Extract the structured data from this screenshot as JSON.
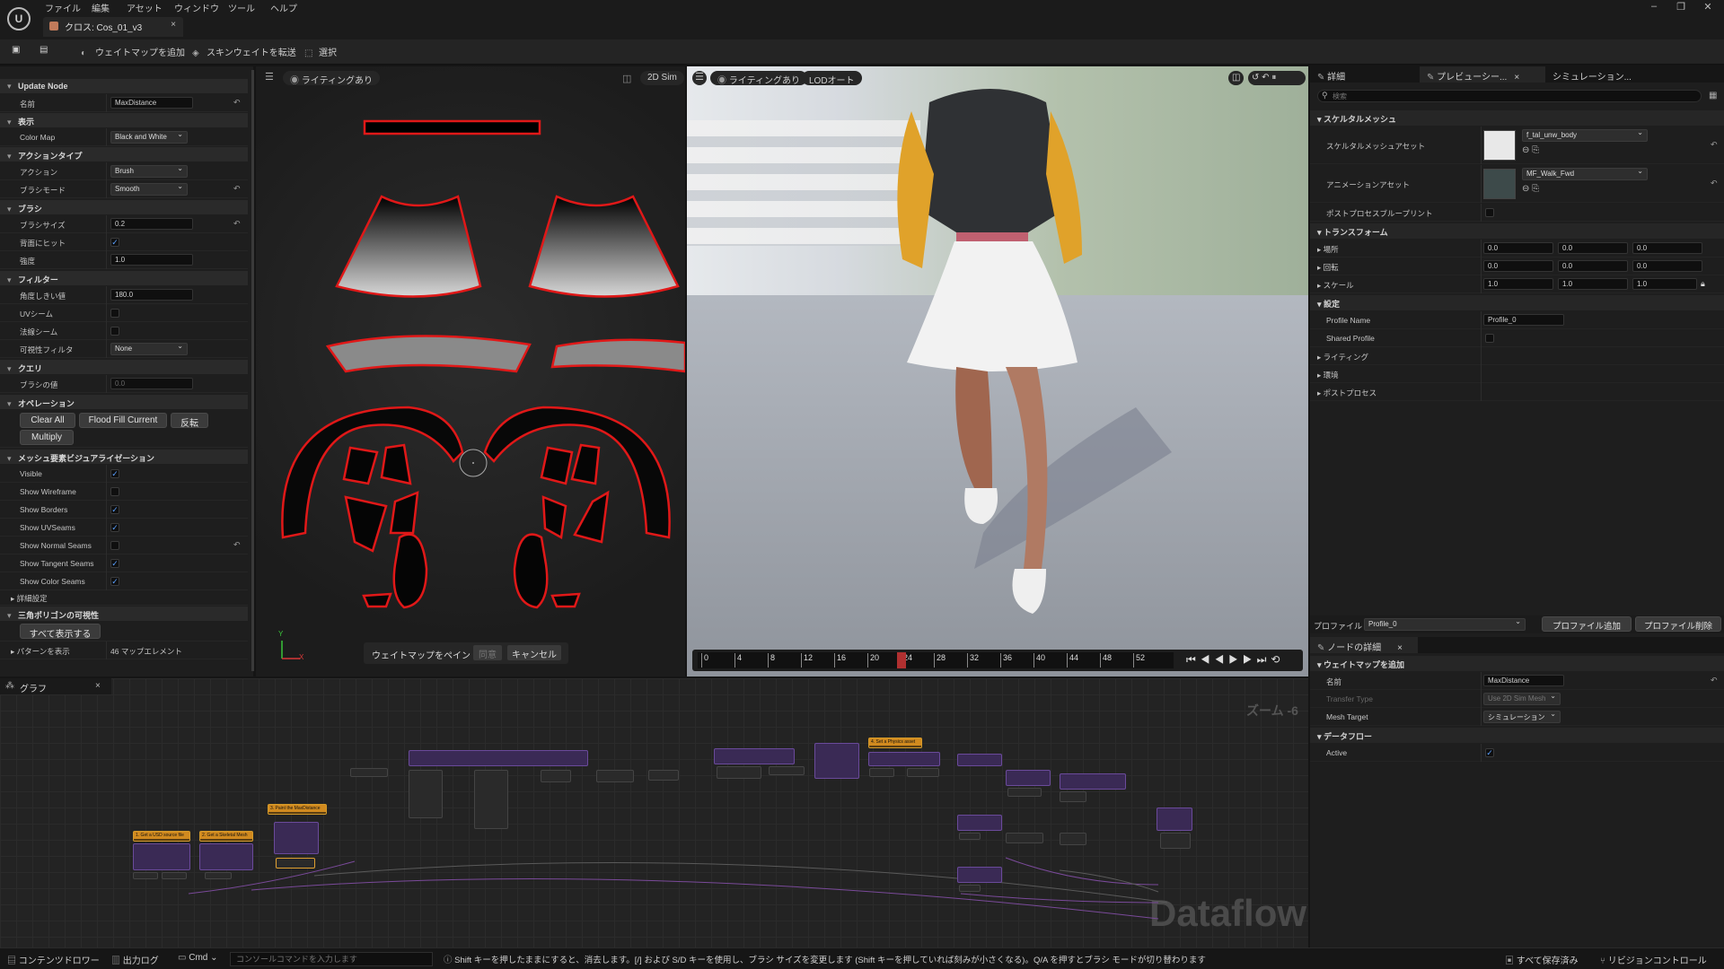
{
  "menu": [
    "ファイル",
    "編集",
    "アセット",
    "ウィンドウ",
    "ツール",
    "ヘルプ"
  ],
  "doc_tab": "クロス: Cos_01_v3",
  "toolbar": {
    "add_weightmap": "ウェイトマップを追加",
    "transfer_skin": "スキンウェイトを転送",
    "select": "選択"
  },
  "left": {
    "update_node": "Update Node",
    "name_label": "名前",
    "name_value": "MaxDistance",
    "display_cat": "表示",
    "color_map_label": "Color Map",
    "color_map_value": "Black and White",
    "action_type_cat": "アクションタイプ",
    "action_label": "アクション",
    "action_value": "Brush",
    "brush_mode_label": "ブラシモード",
    "brush_mode_value": "Smooth",
    "brush_cat": "ブラシ",
    "brush_size_label": "ブラシサイズ",
    "brush_size_value": "0.2",
    "hit_back_label": "背面にヒット",
    "strength_label": "強度",
    "strength_value": "1.0",
    "filter_cat": "フィルター",
    "angle_label": "角度しきい値",
    "angle_value": "180.0",
    "uv_seam_label": "UVシーム",
    "normal_seam_label": "法線シーム",
    "visibility_label": "可視性フィルタ",
    "visibility_value": "None",
    "query_cat": "クエリ",
    "brush_value_label": "ブラシの値",
    "brush_value_value": "0.0",
    "operation_cat": "オペレーション",
    "ops": [
      "Clear All",
      "Flood Fill Current",
      "反転",
      "Multiply"
    ],
    "mesh_vis_cat": "メッシュ要素ビジュアライゼーション",
    "visible_label": "Visible",
    "show_wireframe_label": "Show Wireframe",
    "show_borders_label": "Show Borders",
    "show_uvseams_label": "Show UVSeams",
    "show_normal_seams_label": "Show Normal Seams",
    "show_tangent_seams_label": "Show Tangent Seams",
    "show_color_seams_label": "Show Color Seams",
    "advanced_label": "詳細設定",
    "tri_vis_cat": "三角ポリゴンの可視性",
    "show_all": "すべて表示する",
    "pattern_label": "パターンを表示",
    "pattern_value": "46 マップエレメント"
  },
  "uv_view": {
    "lighting": "ライティングあり",
    "sim2d": "2D Sim",
    "paint_label": "ウェイトマップをペイント",
    "accept": "同意",
    "cancel": "キャンセル",
    "axis_y": "Y",
    "axis_x": "X"
  },
  "viewport": {
    "lighting": "ライティングあり",
    "lod": "LODオート",
    "timeline_ticks": [
      "0",
      "4",
      "8",
      "12",
      "16",
      "20",
      "24",
      "28",
      "32",
      "36",
      "40",
      "44",
      "48",
      "52"
    ],
    "playhead": "24"
  },
  "right": {
    "tabs": [
      "詳細",
      "プレビューシー...",
      "シミュレーション..."
    ],
    "search_placeholder": "検索",
    "skel_cat": "スケルタルメッシュ",
    "skel_asset_label": "スケルタルメッシュアセット",
    "skel_asset_value": "f_tal_unw_body",
    "anim_asset_label": "アニメーションアセット",
    "anim_asset_value": "MF_Walk_Fwd",
    "postprocess_bp_label": "ポストプロセスブループリント",
    "transform_cat": "トランスフォーム",
    "location_label": "場所",
    "location": [
      "0.0",
      "0.0",
      "0.0"
    ],
    "rotation_label": "回転",
    "rotation": [
      "0.0",
      "0.0",
      "0.0"
    ],
    "scale_label": "スケール",
    "scale": [
      "1.0",
      "1.0",
      "1.0"
    ],
    "settings_cat": "設定",
    "profile_name_label": "Profile Name",
    "profile_name_value": "Profile_0",
    "shared_profile_label": "Shared Profile",
    "lighting_label": "ライティング",
    "environment_label": "環境",
    "postprocess_label": "ポストプロセス",
    "profile_label": "プロファイル",
    "profile_value": "Profile_0",
    "add_profile": "プロファイル追加",
    "remove_profile": "プロファイル削除",
    "node_details_tab": "ノードの詳細",
    "add_weightmap_cat": "ウェイトマップを追加",
    "nd_name_label": "名前",
    "nd_name_value": "MaxDistance",
    "transfer_type_label": "Transfer Type",
    "transfer_type_value": "Use 2D Sim Mesh",
    "mesh_target_label": "Mesh Target",
    "mesh_target_value": "シミュレーション",
    "dataflow_cat": "データフロー",
    "active_label": "Active"
  },
  "graph": {
    "tab": "グラフ",
    "zoom": "ズーム -6",
    "watermark": "Dataflow",
    "nodes": [
      "1. Get a USD source file",
      "2. Get a Skeletal Mesh",
      "3. Paint the MaxDistance",
      "4. Set a Physics asset"
    ]
  },
  "status": {
    "content_drawer": "コンテンツドロワー",
    "output_log": "出力ログ",
    "cmd": "Cmd",
    "console_placeholder": "コンソールコマンドを入力します",
    "hint": "Shift キーを押したままにすると、消去します。[/] および S/D キーを使用し、ブラシ サイズを変更します (Shift キーを押していれば刻みが小さくなる)。Q/A を押すとブラシ モードが切り替わります",
    "save_all": "すべて保存済み",
    "revision": "リビジョンコントロール"
  },
  "colors": {
    "accent": "#5aa0ff",
    "uv_outline": "#e01818",
    "node_purple": "#3a2a55",
    "node_orange": "#d18a1f"
  }
}
